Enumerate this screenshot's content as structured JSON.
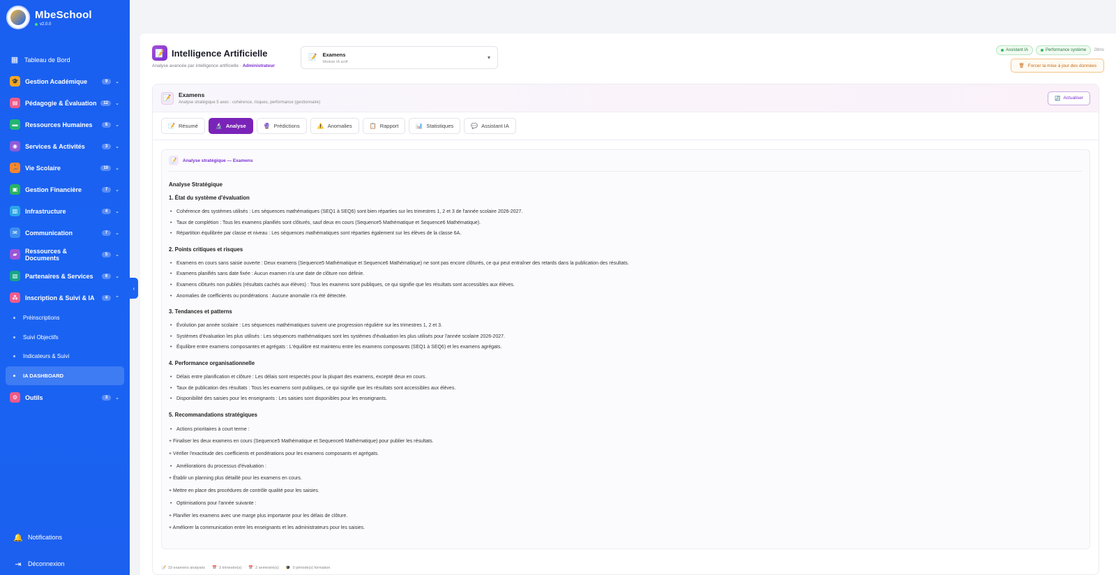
{
  "brand": {
    "name": "MbeSchool",
    "version": "v2.0.0"
  },
  "sidebar": {
    "items": [
      {
        "label": "Tableau de Bord",
        "icon": "dashboard-icon",
        "color": "",
        "badge": "",
        "chev": ""
      },
      {
        "label": "Gestion Académique",
        "icon": "graduation-icon",
        "color": "#f5a623",
        "badge": "9",
        "chev": "⌄"
      },
      {
        "label": "Pédagogie & Évaluation",
        "icon": "chart-icon",
        "color": "#ee5a8a",
        "badge": "12",
        "chev": "⌄"
      },
      {
        "label": "Ressources Humaines",
        "icon": "briefcase-icon",
        "color": "#22b573",
        "badge": "6",
        "chev": "⌄"
      },
      {
        "label": "Services & Activités",
        "icon": "activity-icon",
        "color": "#8e5bd9",
        "badge": "3",
        "chev": "⌄"
      },
      {
        "label": "Vie Scolaire",
        "icon": "person-run-icon",
        "color": "#f7862f",
        "badge": "10",
        "chev": "⌄"
      },
      {
        "label": "Gestion Financière",
        "icon": "finance-icon",
        "color": "#27b364",
        "badge": "7",
        "chev": "⌄"
      },
      {
        "label": "Infrastructure",
        "icon": "building-icon",
        "color": "#2ba6e8",
        "badge": "4",
        "chev": "⌄"
      },
      {
        "label": "Communication",
        "icon": "mail-icon",
        "color": "#3e8ef0",
        "badge": "7",
        "chev": "⌄"
      },
      {
        "label": "Ressources & Documents",
        "icon": "folder-icon",
        "color": "#9a56d8",
        "badge": "5",
        "chev": "⌄"
      },
      {
        "label": "Partenaires & Services",
        "icon": "handshake-icon",
        "color": "#17a589",
        "badge": "6",
        "chev": "⌄"
      },
      {
        "label": "Inscription & Suivi & IA",
        "icon": "ai-icon",
        "color": "#ef5b8e",
        "badge": "4",
        "chev": "⌃"
      }
    ],
    "sub_items": [
      {
        "label": "Préinscriptions"
      },
      {
        "label": "Suivi Objectifs"
      },
      {
        "label": "Indicateurs & Suivi"
      },
      {
        "label": "IA DASHBOARD"
      }
    ],
    "tools": {
      "label": "Outils",
      "icon": "gear-icon",
      "color": "#ee5a8a",
      "badge": "3",
      "chev": "⌄"
    },
    "notifications": "Notifications",
    "logout": "Déconnexion"
  },
  "header": {
    "title": "Intelligence Artificielle",
    "subtitle": "Analyse avancée par intelligence artificielle · ",
    "role": "Administrateur",
    "module_select": {
      "title": "Examens",
      "sub": "Module IA actif"
    },
    "pill_assistant": "Assistant IA",
    "pill_perf": "Performance système",
    "latency": "28ms",
    "force_update": "Forcer la mise à jour des données"
  },
  "panel": {
    "title": "Examens",
    "subtitle": "Analyse stratégique 5 axes : cohérence, risques, performance (gestionnaire)",
    "refresh": "Actualiser",
    "tabs": [
      {
        "label": "Résumé",
        "icon": "📝"
      },
      {
        "label": "Analyse",
        "icon": "🔬"
      },
      {
        "label": "Prédictions",
        "icon": "🔮"
      },
      {
        "label": "Anomalies",
        "icon": "⚠️"
      },
      {
        "label": "Rapport",
        "icon": "📋"
      },
      {
        "label": "Statistiques",
        "icon": "📊"
      },
      {
        "label": "Assistant IA",
        "icon": "💬"
      }
    ]
  },
  "analysis": {
    "header": "Analyse stratégique — Examens",
    "title": "Analyse Stratégique",
    "s1": "1. État du système d'évaluation",
    "s1_items": [
      "Cohérence des systèmes utilisés : Les séquences mathématiques (SEQ1 à SEQ6) sont bien réparties sur les trimestres 1, 2 et 3 de l'année scolaire 2026-2027.",
      "Taux de complétion : Tous les examens planifiés sont clôturés, sauf deux en cours (Sequence5 Mathématique et Sequence6 Mathématique).",
      "Répartition équilibrée par classe et niveau : Les séquences mathématiques sont réparties également sur les élèves de la classe 6A."
    ],
    "s2": "2. Points critiques et risques",
    "s2_items": [
      "Examens en cours sans saisie ouverte : Deux examens (Sequence5 Mathématique et Sequence6 Mathématique) ne sont pas encore clôturés, ce qui peut entraîner des retards dans la publication des résultats.",
      "Examens planifiés sans date fixée : Aucun examen n'a une date de clôture non définie.",
      "Examens clôturés non publiés (résultats cachés aux élèves) : Tous les examens sont publiques, ce qui signifie que les résultats sont accessibles aux élèves.",
      "Anomalies de coefficients ou pondérations : Aucune anomalie n'a été détectée."
    ],
    "s3": "3. Tendances et patterns",
    "s3_items": [
      "Évolution par année scolaire : Les séquences mathématiques suivent une progression régulière sur les trimestres 1, 2 et 3.",
      "Systèmes d'évaluation les plus utilisés : Les séquences mathématiques sont les systèmes d'évaluation les plus utilisés pour l'année scolaire 2026-2027.",
      "Équilibre entre examens composantes et agrégats : L'équilibre est maintenu entre les examens composants (SEQ1 à SEQ6) et les examens agrégats."
    ],
    "s4": "4. Performance organisationnelle",
    "s4_items": [
      "Délais entre planification et clôture : Les délais sont respectés pour la plupart des examens, excepté deux en cours.",
      "Taux de publication des résultats : Tous les examens sont publiques, ce qui signifie que les résultats sont accessibles aux élèves.",
      "Disponibilité des saisies pour les enseignants : Les saisies sont disponibles pour les enseignants."
    ],
    "s5": "5. Recommandations stratégiques",
    "r1": "Actions prioritaires à court terme :",
    "r1_a": "+ Finaliser les deux examens en cours (Sequence5 Mathématique et Sequence6 Mathématique) pour publier les résultats.",
    "r1_b": "+ Vérifier l'exactitude des coefficients et pondérations pour les examens composants et agrégats.",
    "r2": "Améliorations du processus d'évaluation :",
    "r2_a": "+ Établir un planning plus détaillé pour les examens en cours.",
    "r2_b": "+ Mettre en place des procédures de contrôle qualité pour les saisies.",
    "r3": "Optimisations pour l'année suivante :",
    "r3_a": "+ Planifier les examens avec une marge plus importante pour les délais de clôture.",
    "r3_b": "+ Améliorer la communication entre les enseignants et les administrateurs pour les saisies."
  },
  "footer": {
    "exams": "19 examens analysés",
    "trimesters": "3 trimestre(s)",
    "semesters": "2 semestre(s)",
    "periods": "0 période(s) formation"
  }
}
